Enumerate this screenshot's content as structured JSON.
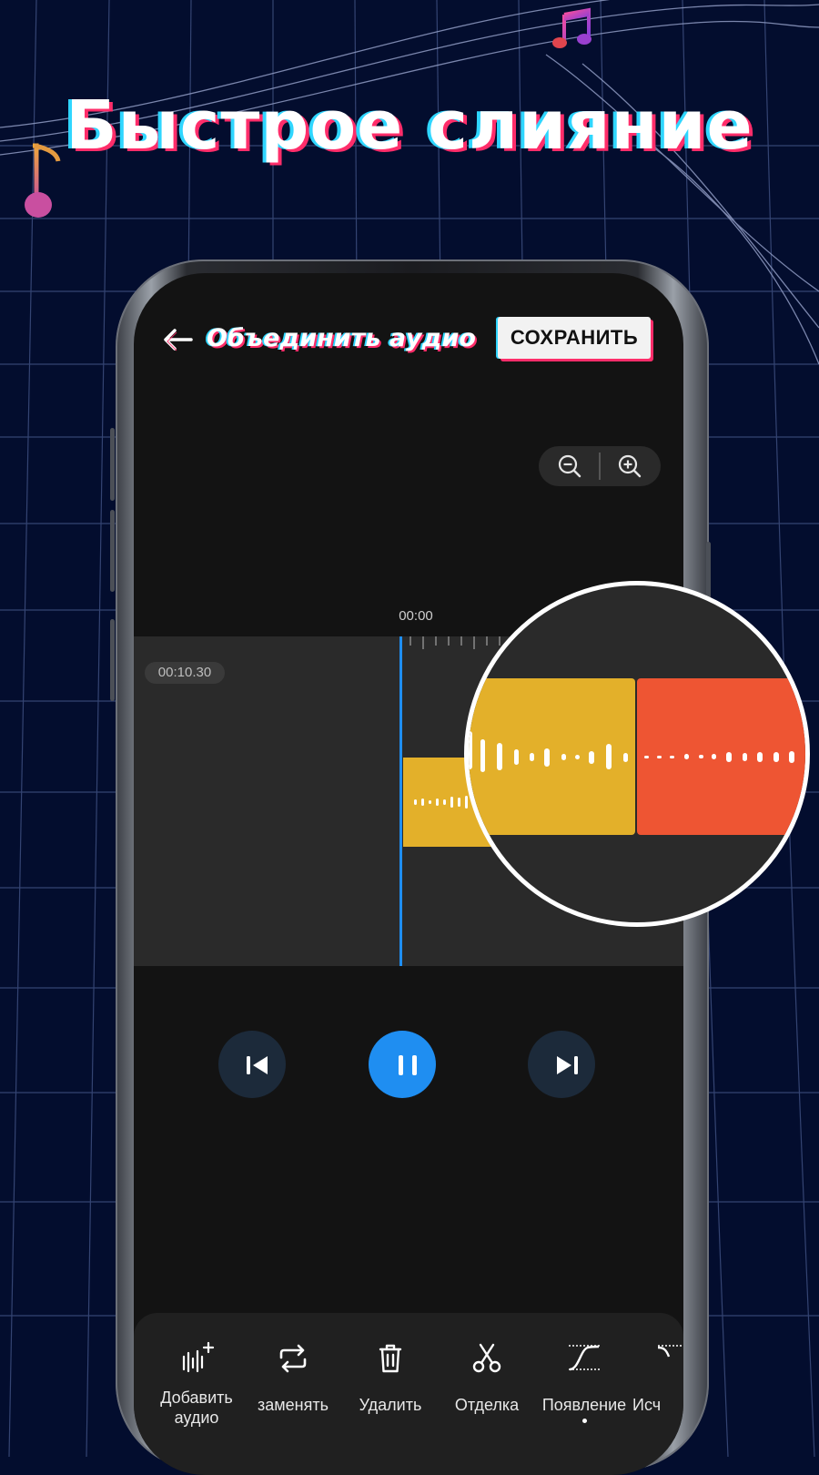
{
  "headline": "Быстрое слияние",
  "app": {
    "title": "Объединить аудио",
    "save_label": "СОХРАНИТЬ",
    "timeline": {
      "playhead_time": "00:00",
      "clip_time": "00:10.30"
    },
    "tools": [
      {
        "label": "Добавить аудио",
        "icon": "add-audio-icon"
      },
      {
        "label": "заменять",
        "icon": "replace-icon"
      },
      {
        "label": "Удалить",
        "icon": "trash-icon"
      },
      {
        "label": "Отделка",
        "icon": "scissors-icon"
      },
      {
        "label": "Появление",
        "icon": "fade-in-icon"
      },
      {
        "label": "Исч",
        "icon": "fade-out-icon"
      }
    ],
    "colors": {
      "accent": "#1f8ef1",
      "clip_1": "#e3b02a",
      "clip_2": "#ee5533",
      "background": "#030d2e"
    }
  }
}
